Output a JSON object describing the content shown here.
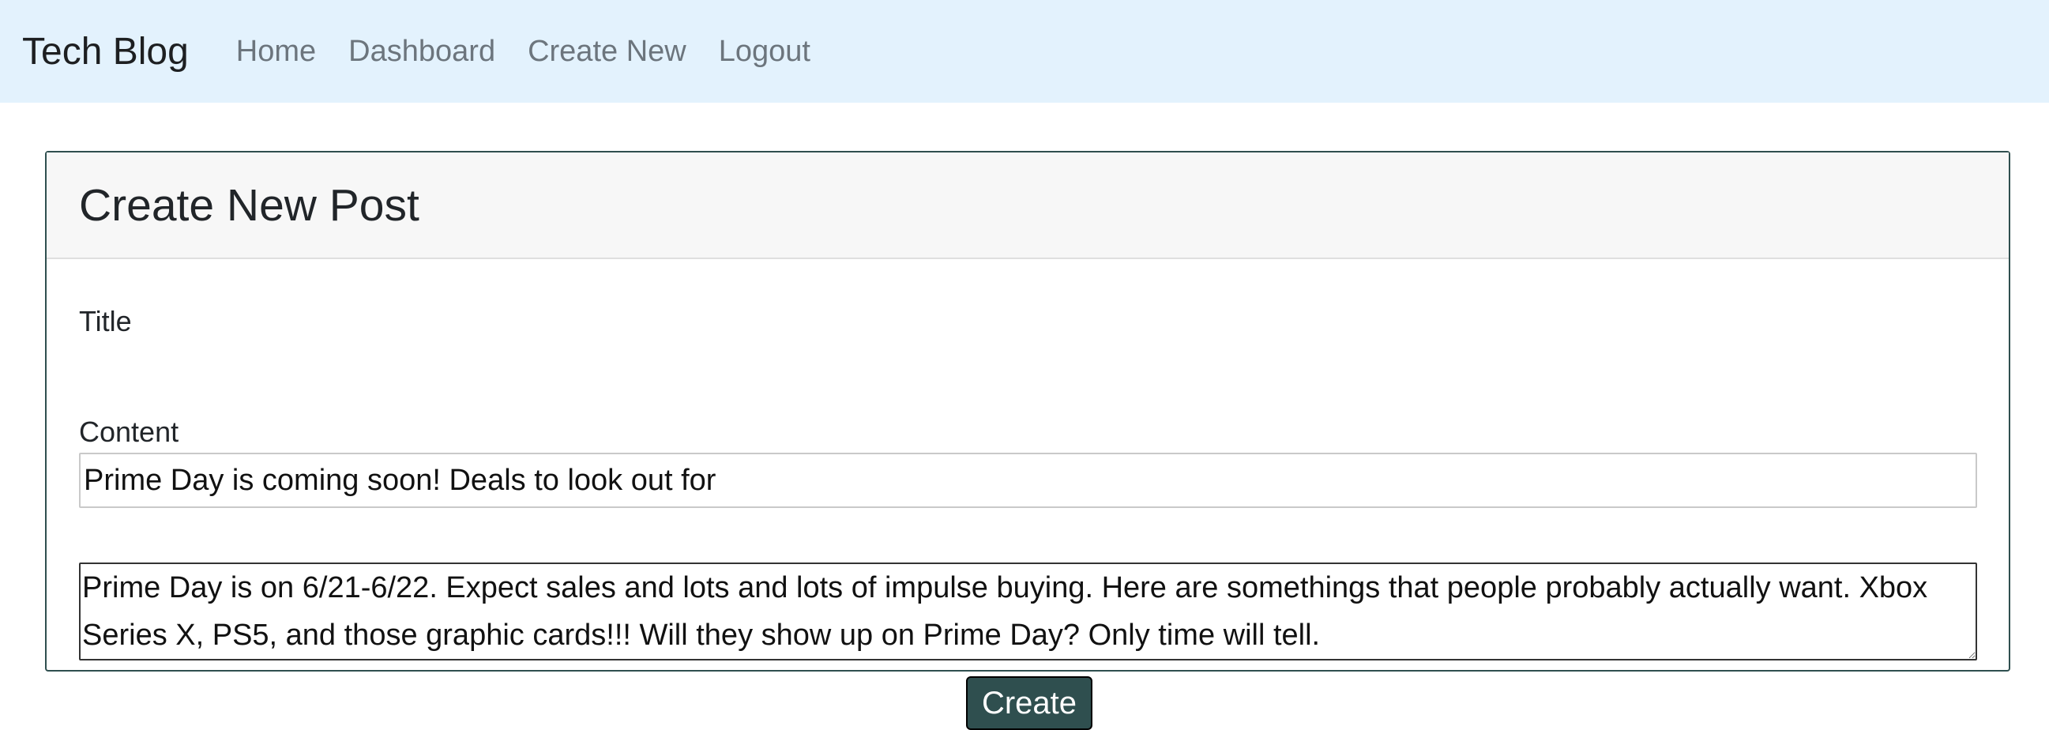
{
  "navbar": {
    "brand": "Tech Blog",
    "links": [
      {
        "label": "Home"
      },
      {
        "label": "Dashboard"
      },
      {
        "label": "Create New"
      },
      {
        "label": "Logout"
      }
    ],
    "background_color": "#e3f2fd"
  },
  "form": {
    "heading": "Create New Post",
    "title_label": "Title",
    "title_value": "Prime Day is coming soon! Deals to look out for",
    "content_label": "Content",
    "content_value": "Prime Day is on 6/21-6/22. Expect sales and lots and lots of impulse buying. Here are somethings that people probably actually want. Xbox Series X, PS5, and those graphic cards!!! Will they show up on Prime Day? Only time will tell.",
    "submit_label": "Create",
    "accent_color": "#2f4f4f"
  }
}
